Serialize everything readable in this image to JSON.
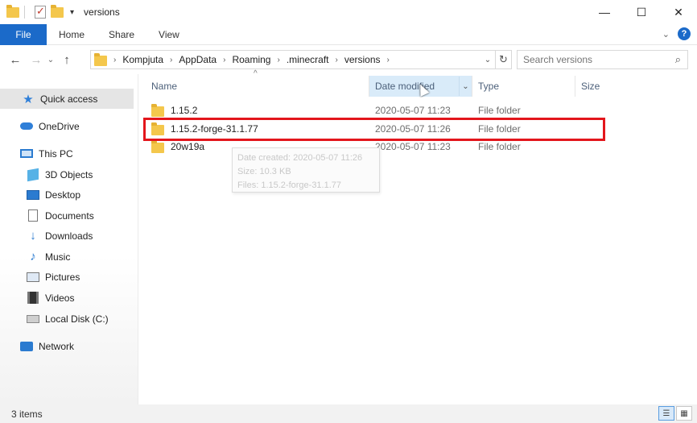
{
  "window": {
    "title": "versions",
    "controls": {
      "minimize": "—",
      "maximize": "☐",
      "close": "✕"
    }
  },
  "ribbon": {
    "tabs": [
      "File",
      "Home",
      "Share",
      "View"
    ],
    "expand_icon": "chevron-down-icon",
    "help_label": "?"
  },
  "nav": {
    "back": "←",
    "forward": "→",
    "recent": "⌄",
    "up": "↑",
    "breadcrumb": [
      "Kompjuta",
      "AppData",
      "Roaming",
      ".minecraft",
      "versions"
    ],
    "separator": "›",
    "search_placeholder": "Search versions"
  },
  "sidebar": {
    "items": [
      {
        "label": "Quick access",
        "icon": "star-icon"
      },
      {
        "label": "OneDrive",
        "icon": "cloud-icon"
      },
      {
        "label": "This PC",
        "icon": "computer-icon"
      },
      {
        "label": "3D Objects",
        "icon": "cube-icon"
      },
      {
        "label": "Desktop",
        "icon": "desktop-icon"
      },
      {
        "label": "Documents",
        "icon": "document-icon"
      },
      {
        "label": "Downloads",
        "icon": "download-icon"
      },
      {
        "label": "Music",
        "icon": "music-icon"
      },
      {
        "label": "Pictures",
        "icon": "pictures-icon"
      },
      {
        "label": "Videos",
        "icon": "video-icon"
      },
      {
        "label": "Local Disk (C:)",
        "icon": "disk-icon"
      },
      {
        "label": "Network",
        "icon": "network-icon"
      }
    ]
  },
  "columns": {
    "name": "Name",
    "date": "Date modified",
    "type": "Type",
    "size": "Size"
  },
  "files": [
    {
      "name": "1.15.2",
      "date": "2020-05-07 11:23",
      "type": "File folder"
    },
    {
      "name": "1.15.2-forge-31.1.77",
      "date": "2020-05-07 11:26",
      "type": "File folder"
    },
    {
      "name": "20w19a",
      "date": "2020-05-07 11:23",
      "type": "File folder"
    }
  ],
  "tooltip": {
    "created": "Date created: 2020-05-07 11:26",
    "size": "Size: 10.3 KB",
    "files": "Files: 1.15.2-forge-31.1.77"
  },
  "status": {
    "count": "3 items"
  },
  "colors": {
    "accent": "#1b6ac9",
    "highlight_border": "#e3161c",
    "folder": "#f4c74c"
  }
}
